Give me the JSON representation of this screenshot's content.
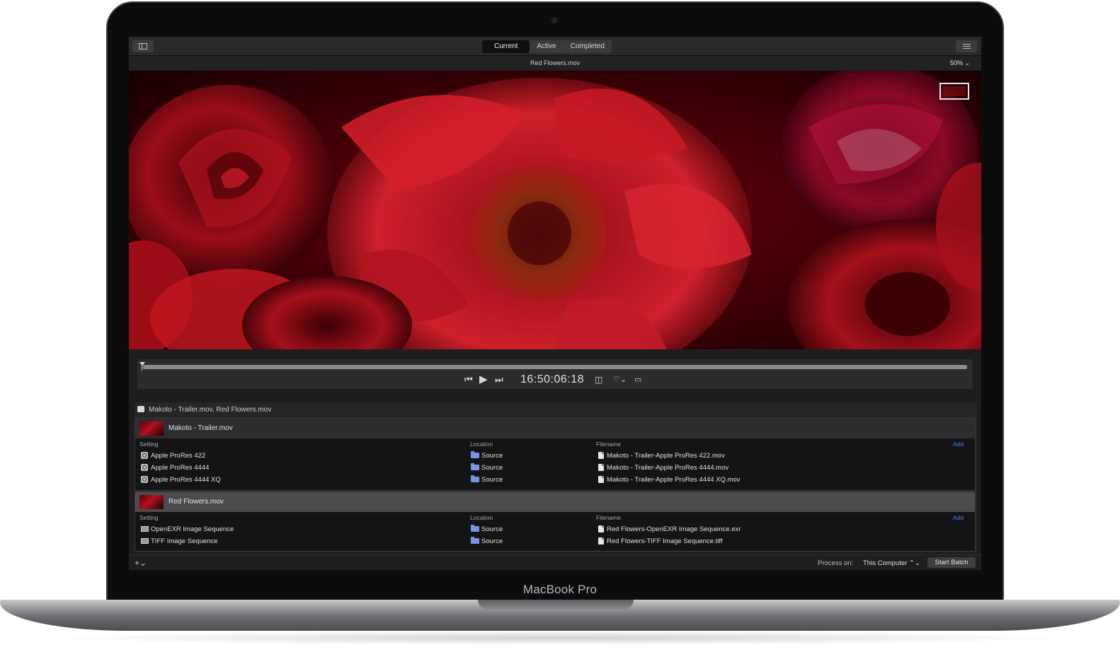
{
  "device": {
    "label": "MacBook Pro"
  },
  "toolbar": {
    "sidebar_icon": "sidebar-toggle-icon",
    "tabs": [
      {
        "label": "Current",
        "selected": true
      },
      {
        "label": "Active",
        "selected": false
      },
      {
        "label": "Completed",
        "selected": false
      }
    ],
    "inspector_icon": "sliders-icon"
  },
  "viewer": {
    "file_title": "Red Flowers.mov",
    "zoom": "50% ⌄"
  },
  "transport": {
    "timecode": "16:50:06:18",
    "prev_icon": "skip-back-icon",
    "play_icon": "play-icon",
    "next_icon": "skip-forward-icon",
    "playhead_position": 0.003
  },
  "batch": {
    "title": "Makoto - Trailer.mov, Red Flowers.mov",
    "jobs": [
      {
        "name": "Makoto - Trailer.mov",
        "selected": false,
        "columns": {
          "setting": "Setting",
          "location": "Location",
          "filename": "Filename",
          "add": "Add"
        },
        "rows": [
          {
            "setting": "Apple ProRes 422",
            "location": "Source",
            "filename": "Makoto - Trailer-Apple ProRes 422.mov"
          },
          {
            "setting": "Apple ProRes 4444",
            "location": "Source",
            "filename": "Makoto - Trailer-Apple ProRes 4444.mov"
          },
          {
            "setting": "Apple ProRes 4444 XQ",
            "location": "Source",
            "filename": "Makoto - Trailer-Apple ProRes 4444 XQ.mov"
          }
        ]
      },
      {
        "name": "Red Flowers.mov",
        "selected": true,
        "columns": {
          "setting": "Setting",
          "location": "Location",
          "filename": "Filename",
          "add": "Add"
        },
        "rows": [
          {
            "setting": "OpenEXR Image Sequence",
            "location": "Source",
            "filename": "Red Flowers-OpenEXR Image Sequence.exr"
          },
          {
            "setting": "TIFF Image Sequence",
            "location": "Source",
            "filename": "Red Flowers-TIFF Image Sequence.tiff"
          }
        ]
      }
    ]
  },
  "footer": {
    "add_menu": "+⌄",
    "process_label": "Process on:",
    "process_value": "This Computer ⌃⌄",
    "start_button": "Start Batch"
  },
  "colors": {
    "accent": "#4d7cff",
    "screen_bg": "#1d1d1f",
    "viewer_red": "#b3101e"
  }
}
